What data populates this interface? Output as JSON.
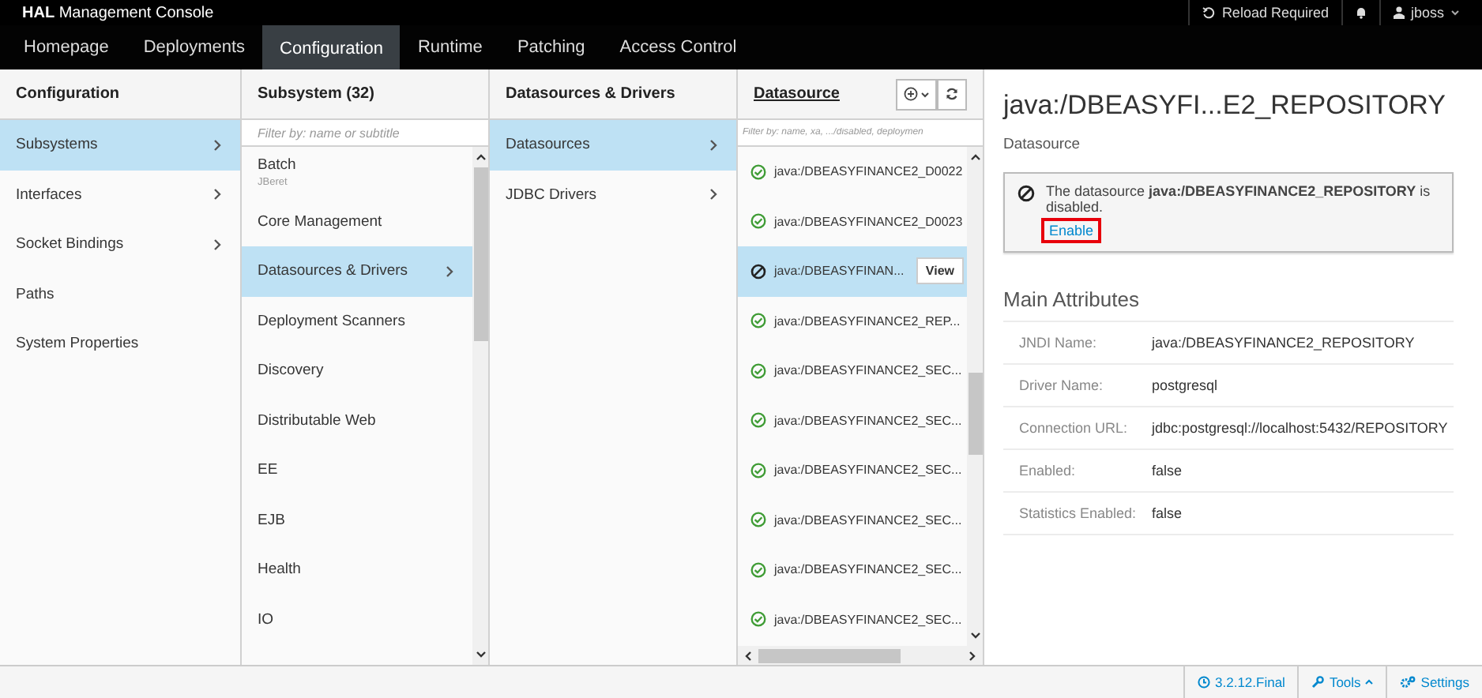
{
  "header": {
    "title": "**HAL** Management Console",
    "reload": "Reload Required",
    "user": "jboss"
  },
  "nav_tabs": [
    {
      "label": "Homepage",
      "selected": false
    },
    {
      "label": "Deployments",
      "selected": false
    },
    {
      "label": "Configuration",
      "selected": true
    },
    {
      "label": "Runtime",
      "selected": false
    },
    {
      "label": "Patching",
      "selected": false
    },
    {
      "label": "Access Control",
      "selected": false
    }
  ],
  "columns": [
    {
      "title": "Configuration",
      "items": [
        {
          "label": "Subsystems",
          "selected": true,
          "has_children": true
        },
        {
          "label": "Interfaces",
          "selected": false,
          "has_children": true
        },
        {
          "label": "Socket Bindings",
          "selected": false,
          "has_children": true
        },
        {
          "label": "Paths",
          "selected": false,
          "has_children": false
        },
        {
          "label": "System Properties",
          "selected": false,
          "has_children": false
        }
      ]
    },
    {
      "title": "Subsystem (32)",
      "placeholder": "Filter by: name or subtitle",
      "items": [
        {
          "label": "Batch",
          "subtitle": "JBeret",
          "selected": false,
          "has_children": false
        },
        {
          "label": "Core Management",
          "selected": false,
          "has_children": false
        },
        {
          "label": "Datasources & Drivers",
          "selected": true,
          "has_children": true
        },
        {
          "label": "Deployment Scanners",
          "selected": false,
          "has_children": false
        },
        {
          "label": "Discovery",
          "selected": false,
          "has_children": false
        },
        {
          "label": "Distributable Web",
          "selected": false,
          "has_children": false
        },
        {
          "label": "EE",
          "selected": false,
          "has_children": false
        },
        {
          "label": "EJB",
          "selected": false,
          "has_children": false
        },
        {
          "label": "Health",
          "selected": false,
          "has_children": false
        },
        {
          "label": "IO",
          "selected": false,
          "has_children": false
        }
      ]
    },
    {
      "title": "Datasources & Drivers",
      "items": [
        {
          "label": "Datasources",
          "selected": true,
          "has_children": true
        },
        {
          "label": "JDBC Drivers",
          "selected": false,
          "has_children": true
        }
      ]
    }
  ],
  "datasource_column": {
    "title": "Datasource",
    "placeholder": "Filter by: name, xa, .../disabled, deploymen",
    "view_button": "View",
    "items": [
      {
        "label": "java:/DBEASYFINANCE2_D0022",
        "disabled": false,
        "selected": false
      },
      {
        "label": "java:/DBEASYFINANCE2_D0023",
        "disabled": false,
        "selected": false
      },
      {
        "label": "java:/DBEASYFINAN...",
        "disabled": true,
        "selected": true
      },
      {
        "label": "java:/DBEASYFINANCE2_REP...",
        "disabled": false,
        "selected": false
      },
      {
        "label": "java:/DBEASYFINANCE2_SEC...",
        "disabled": false,
        "selected": false
      },
      {
        "label": "java:/DBEASYFINANCE2_SEC...",
        "disabled": false,
        "selected": false
      },
      {
        "label": "java:/DBEASYFINANCE2_SEC...",
        "disabled": false,
        "selected": false
      },
      {
        "label": "java:/DBEASYFINANCE2_SEC...",
        "disabled": false,
        "selected": false
      },
      {
        "label": "java:/DBEASYFINANCE2_SEC...",
        "disabled": false,
        "selected": false
      },
      {
        "label": "java:/DBEASYFINANCE2_SEC...",
        "disabled": false,
        "selected": false
      }
    ]
  },
  "detail": {
    "title": "java:/DBEASYFI...E2_REPOSITORY",
    "subtitle": "Datasource",
    "alert": {
      "text": "The datasource **java:/DBEASYFINANCE2_REPOSITORY** is disabled.",
      "link": "Enable",
      "link_highlighted": true
    },
    "section_title": "Main Attributes",
    "attributes": [
      {
        "label": "JNDI Name:",
        "value": "java:/DBEASYFINANCE2_REPOSITORY"
      },
      {
        "label": "Driver Name:",
        "value": "postgresql"
      },
      {
        "label": "Connection URL:",
        "value": "jdbc:postgresql://localhost:5432/REPOSITORY"
      },
      {
        "label": "Enabled:",
        "value": "false"
      },
      {
        "label": "Statistics Enabled:",
        "value": "false"
      }
    ]
  },
  "footer": {
    "version": "3.2.12.Final",
    "tools": "Tools",
    "settings": "Settings"
  }
}
